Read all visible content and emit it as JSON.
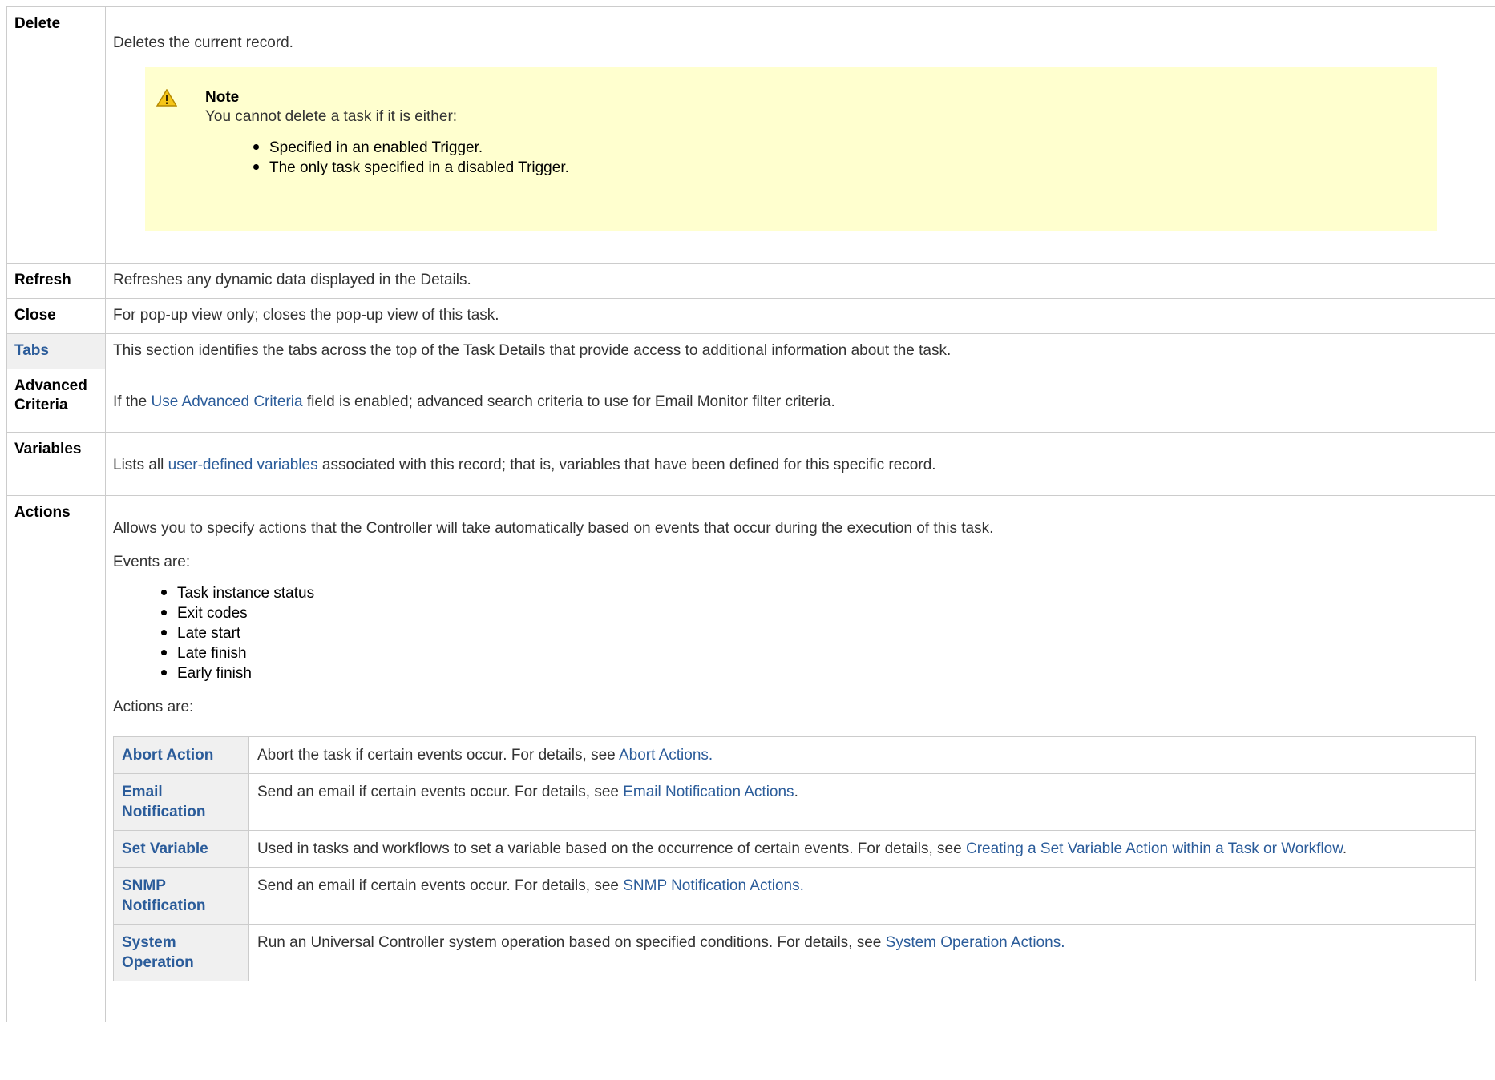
{
  "rows": {
    "delete": {
      "label": "Delete",
      "desc": "Deletes the current record.",
      "note": {
        "title": "Note",
        "intro": "You cannot delete a task if it is either:",
        "items": [
          "Specified in an enabled Trigger.",
          "The only task specified in a disabled Trigger."
        ]
      }
    },
    "refresh": {
      "label": "Refresh",
      "desc": "Refreshes any dynamic data displayed in the Details."
    },
    "close": {
      "label": "Close",
      "desc": "For pop-up view only; closes the pop-up view of this task."
    },
    "tabs": {
      "label": "Tabs",
      "desc": "This section identifies the tabs across the top of the Task Details that provide access to additional information about the task."
    },
    "advanced": {
      "label": "Advanced Criteria",
      "desc_pre": "If the ",
      "desc_link": "Use Advanced Criteria",
      "desc_post": " field is enabled; advanced search criteria to use for Email Monitor filter criteria."
    },
    "variables": {
      "label": "Variables",
      "desc_pre": "Lists all ",
      "desc_link": "user-defined variables",
      "desc_post": " associated with this record; that is, variables that have been defined for this specific record."
    },
    "actions": {
      "label": "Actions",
      "desc": "Allows you to specify actions that the Controller will take automatically based on events that occur during the execution of this task.",
      "events_label": "Events are:",
      "events": [
        "Task instance status",
        "Exit codes",
        "Late start",
        "Late finish",
        "Early finish"
      ],
      "actions_label": "Actions are:",
      "table": [
        {
          "name": "Abort Action",
          "pre": "Abort the task if certain events occur. For details, see ",
          "link": "Abort Actions.",
          "post": ""
        },
        {
          "name": "Email Notification",
          "pre": "Send an email if certain events occur. For details, see ",
          "link": "Email Notification Actions",
          "post": "."
        },
        {
          "name": "Set Variable",
          "pre": "Used in tasks and workflows to set a variable based on the occurrence of certain events. For details, see ",
          "link": "Creating a Set Variable Action within a Task or Workflow",
          "post": "."
        },
        {
          "name": "SNMP Notification",
          "pre": "Send an email if certain events occur. For details, see ",
          "link": "SNMP Notification Actions.",
          "post": ""
        },
        {
          "name": "System Operation",
          "pre": "Run an Universal Controller system operation based on specified conditions. For details, see ",
          "link": "System Operation Actions.",
          "post": ""
        }
      ]
    }
  }
}
